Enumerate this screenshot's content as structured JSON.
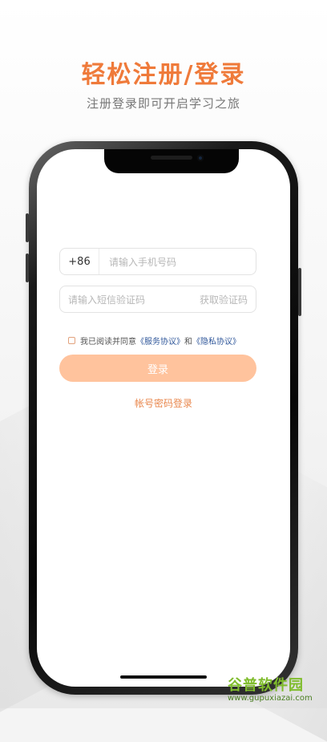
{
  "header": {
    "title": "轻松注册/登录",
    "subtitle": "注册登录即可开启学习之旅"
  },
  "login": {
    "country_code": "+86",
    "phone_placeholder": "请输入手机号码",
    "code_placeholder": "请输入短信验证码",
    "get_code_label": "获取验证码",
    "agreement_prefix": "我已阅读并同意",
    "service_agreement": "《服务协议》",
    "agreement_and": "和",
    "privacy_agreement": "《隐私协议》",
    "login_button": "登录",
    "password_login": "帐号密码登录"
  },
  "watermark": {
    "brand": "谷普软件园",
    "url": "www.gupuxiazai.com"
  },
  "colors": {
    "accent": "#ef7a3a",
    "button": "#ffc39d",
    "link": "#31589b",
    "watermark": "#7fbc2c"
  }
}
